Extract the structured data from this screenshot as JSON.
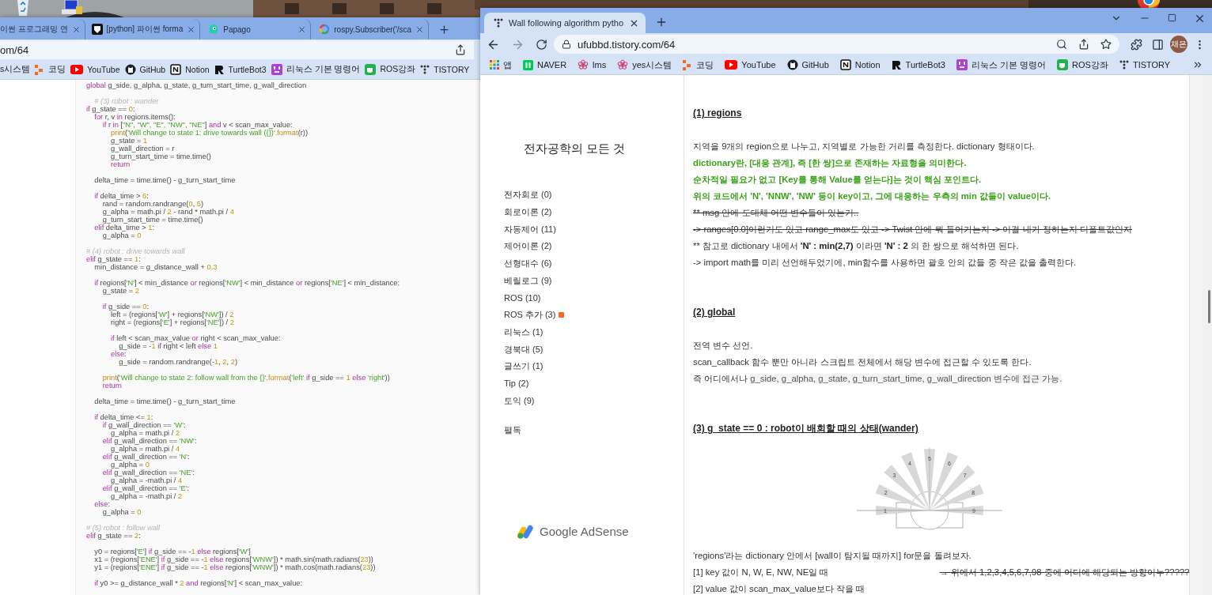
{
  "left_window": {
    "tabs": [
      {
        "title": "이썬 프로그래밍 연",
        "selected": false
      },
      {
        "kind": "python",
        "title": "[python] 파이썬 forma",
        "selected": false
      },
      {
        "kind": "papago",
        "title": "Papago",
        "selected": false
      },
      {
        "kind": "google",
        "title": "rospy.Subscriber('/sca",
        "selected": false
      }
    ],
    "address": "om/64",
    "bookmarks": [
      {
        "label": "s시스템"
      },
      {
        "kind": "coding",
        "label": "코딩"
      },
      {
        "kind": "youtube",
        "label": "YouTube"
      },
      {
        "kind": "github",
        "label": "GitHub"
      },
      {
        "kind": "notion",
        "label": "Notion"
      },
      {
        "kind": "turtlebot",
        "label": "TurtleBot3"
      },
      {
        "kind": "linux",
        "label": "리눅스 기본 명령어"
      },
      {
        "kind": "ros",
        "label": "ROS강좌"
      },
      {
        "kind": "tistory",
        "label": "TISTORY"
      }
    ],
    "code_blocks": [
      [
        {
          "spans": [
            {
              "kind": "keyword",
              "text": "global"
            },
            {
              "kind": "plain",
              "text": " g_side, g_alpha, g_state, g_turn_start_time, g_wall_direction"
            }
          ]
        }
      ],
      [
        {
          "spans": [
            {
              "kind": "comment",
              "text": "    # (3) robot : wander"
            }
          ]
        },
        {
          "spans": [
            {
              "kind": "keyword",
              "text": "if"
            },
            {
              "kind": "plain",
              "text": " g_state == "
            },
            {
              "kind": "number",
              "text": "0"
            },
            {
              "kind": "plain",
              "text": ":"
            }
          ]
        },
        {
          "spans": [
            {
              "kind": "keyword",
              "text": "    for"
            },
            {
              "kind": "plain",
              "text": " r, v "
            },
            {
              "kind": "keyword",
              "text": "in"
            },
            {
              "kind": "plain",
              "text": " regions.items():"
            }
          ]
        },
        {
          "spans": [
            {
              "kind": "keyword",
              "text": "        if"
            },
            {
              "kind": "plain",
              "text": " r "
            },
            {
              "kind": "keyword",
              "text": "in"
            },
            {
              "kind": "plain",
              "text": " ["
            },
            {
              "kind": "string",
              "text": "\"N\", \"W\", \"E\", \"NW\", \"NE\""
            },
            {
              "kind": "plain",
              "text": "] "
            },
            {
              "kind": "keyword",
              "text": "and"
            },
            {
              "kind": "plain",
              "text": " v < scan_max_value:"
            }
          ]
        },
        {
          "spans": [
            {
              "kind": "builtin",
              "text": "            print"
            },
            {
              "kind": "plain",
              "text": "("
            },
            {
              "kind": "string",
              "text": "'Will change to state 1: drive towards wall ({})'"
            },
            {
              "kind": "builtin",
              "text": ".format"
            },
            {
              "kind": "plain",
              "text": "(r))"
            }
          ]
        },
        {
          "spans": [
            {
              "kind": "plain",
              "text": "            g_state = "
            },
            {
              "kind": "number",
              "text": "1"
            }
          ]
        },
        {
          "spans": [
            {
              "kind": "plain",
              "text": "            g_wall_direction = r"
            }
          ]
        },
        {
          "spans": [
            {
              "kind": "plain",
              "text": "            g_turn_start_time = time.time()"
            }
          ]
        },
        {
          "spans": [
            {
              "kind": "keyword",
              "text": "            return"
            }
          ]
        }
      ],
      [
        {
          "spans": [
            {
              "kind": "plain",
              "text": "    delta_time = time.time() - g_turn_start_time"
            }
          ]
        }
      ],
      [
        {
          "spans": [
            {
              "kind": "keyword",
              "text": "    if"
            },
            {
              "kind": "plain",
              "text": " delta_time > "
            },
            {
              "kind": "number",
              "text": "6"
            },
            {
              "kind": "plain",
              "text": ":"
            }
          ]
        },
        {
          "spans": [
            {
              "kind": "plain",
              "text": "        rand = random.randrange("
            },
            {
              "kind": "number",
              "text": "0"
            },
            {
              "kind": "plain",
              "text": ", "
            },
            {
              "kind": "number",
              "text": "5"
            },
            {
              "kind": "plain",
              "text": ")"
            }
          ]
        },
        {
          "spans": [
            {
              "kind": "plain",
              "text": "        g_alpha = math.pi / "
            },
            {
              "kind": "number",
              "text": "2"
            },
            {
              "kind": "plain",
              "text": " - rand * math.pi / "
            },
            {
              "kind": "number",
              "text": "4"
            }
          ]
        },
        {
          "spans": [
            {
              "kind": "plain",
              "text": "        g_turn_start_time = time.time()"
            }
          ]
        },
        {
          "spans": [
            {
              "kind": "keyword",
              "text": "    elif"
            },
            {
              "kind": "plain",
              "text": " delta_time > "
            },
            {
              "kind": "number",
              "text": "1"
            },
            {
              "kind": "plain",
              "text": ":"
            }
          ]
        },
        {
          "spans": [
            {
              "kind": "plain",
              "text": "        g_alpha = "
            },
            {
              "kind": "number",
              "text": "0"
            }
          ]
        }
      ],
      [
        {
          "spans": [
            {
              "kind": "comment",
              "text": "# (4) robot : drive towards wall"
            }
          ]
        },
        {
          "spans": [
            {
              "kind": "keyword",
              "text": "elif"
            },
            {
              "kind": "plain",
              "text": " g_state == "
            },
            {
              "kind": "number",
              "text": "1"
            },
            {
              "kind": "plain",
              "text": ":"
            }
          ]
        },
        {
          "spans": [
            {
              "kind": "plain",
              "text": "    min_distance = g_distance_wall + "
            },
            {
              "kind": "number",
              "text": "0.3"
            }
          ]
        }
      ],
      [
        {
          "spans": [
            {
              "kind": "keyword",
              "text": "    if"
            },
            {
              "kind": "plain",
              "text": " regions["
            },
            {
              "kind": "string",
              "text": "'N'"
            },
            {
              "kind": "plain",
              "text": "] < min_distance "
            },
            {
              "kind": "keyword",
              "text": "or"
            },
            {
              "kind": "plain",
              "text": " regions["
            },
            {
              "kind": "string",
              "text": "'NW'"
            },
            {
              "kind": "plain",
              "text": "] < min_distance "
            },
            {
              "kind": "keyword",
              "text": "or"
            },
            {
              "kind": "plain",
              "text": " regions["
            },
            {
              "kind": "string",
              "text": "'NE'"
            },
            {
              "kind": "plain",
              "text": "] < min_distance:"
            }
          ]
        },
        {
          "spans": [
            {
              "kind": "plain",
              "text": "        g_state = "
            },
            {
              "kind": "number",
              "text": "2"
            }
          ]
        }
      ],
      [
        {
          "spans": [
            {
              "kind": "keyword",
              "text": "        if"
            },
            {
              "kind": "plain",
              "text": " g_side == "
            },
            {
              "kind": "number",
              "text": "0"
            },
            {
              "kind": "plain",
              "text": ":"
            }
          ]
        },
        {
          "spans": [
            {
              "kind": "plain",
              "text": "            left = (regions["
            },
            {
              "kind": "string",
              "text": "'W'"
            },
            {
              "kind": "plain",
              "text": "] + regions["
            },
            {
              "kind": "string",
              "text": "'NW'"
            },
            {
              "kind": "plain",
              "text": "]) / "
            },
            {
              "kind": "number",
              "text": "2"
            }
          ]
        },
        {
          "spans": [
            {
              "kind": "plain",
              "text": "            right = (regions["
            },
            {
              "kind": "string",
              "text": "'E'"
            },
            {
              "kind": "plain",
              "text": "] + regions["
            },
            {
              "kind": "string",
              "text": "'NE'"
            },
            {
              "kind": "plain",
              "text": "]) / "
            },
            {
              "kind": "number",
              "text": "2"
            }
          ]
        }
      ],
      [
        {
          "spans": [
            {
              "kind": "keyword",
              "text": "            if"
            },
            {
              "kind": "plain",
              "text": " left < scan_max_value "
            },
            {
              "kind": "keyword",
              "text": "or"
            },
            {
              "kind": "plain",
              "text": " right < scan_max_value:"
            }
          ]
        },
        {
          "spans": [
            {
              "kind": "plain",
              "text": "                g_side = -"
            },
            {
              "kind": "number",
              "text": "1"
            },
            {
              "kind": "keyword",
              "text": " if"
            },
            {
              "kind": "plain",
              "text": " right < left "
            },
            {
              "kind": "keyword",
              "text": "else"
            },
            {
              "kind": "number",
              "text": " 1"
            }
          ]
        },
        {
          "spans": [
            {
              "kind": "keyword",
              "text": "            else"
            },
            {
              "kind": "plain",
              "text": ":"
            }
          ]
        },
        {
          "spans": [
            {
              "kind": "plain",
              "text": "                g_side = random.randrange(-"
            },
            {
              "kind": "number",
              "text": "1"
            },
            {
              "kind": "plain",
              "text": ", "
            },
            {
              "kind": "number",
              "text": "2"
            },
            {
              "kind": "plain",
              "text": ", "
            },
            {
              "kind": "number",
              "text": "2"
            },
            {
              "kind": "plain",
              "text": ")"
            }
          ]
        }
      ],
      [
        {
          "spans": [
            {
              "kind": "builtin",
              "text": "        print"
            },
            {
              "kind": "plain",
              "text": "("
            },
            {
              "kind": "string",
              "text": "'Will change to state 2: follow wall from the {}'"
            },
            {
              "kind": "builtin",
              "text": ".format"
            },
            {
              "kind": "plain",
              "text": "("
            },
            {
              "kind": "string",
              "text": "'left'"
            },
            {
              "kind": "keyword",
              "text": " if"
            },
            {
              "kind": "plain",
              "text": " g_side == "
            },
            {
              "kind": "number",
              "text": "1"
            },
            {
              "kind": "keyword",
              "text": " else"
            },
            {
              "kind": "string",
              "text": " 'right'"
            },
            {
              "kind": "plain",
              "text": "))"
            }
          ]
        },
        {
          "spans": [
            {
              "kind": "keyword",
              "text": "        return"
            }
          ]
        }
      ],
      [
        {
          "spans": [
            {
              "kind": "plain",
              "text": "    delta_time = time.time() - g_turn_start_time"
            }
          ]
        }
      ],
      [
        {
          "spans": [
            {
              "kind": "keyword",
              "text": "    if"
            },
            {
              "kind": "plain",
              "text": " delta_time <= "
            },
            {
              "kind": "number",
              "text": "1"
            },
            {
              "kind": "plain",
              "text": ":"
            }
          ]
        },
        {
          "spans": [
            {
              "kind": "keyword",
              "text": "        if"
            },
            {
              "kind": "plain",
              "text": " g_wall_direction == "
            },
            {
              "kind": "string",
              "text": "'W'"
            },
            {
              "kind": "plain",
              "text": ":"
            }
          ]
        },
        {
          "spans": [
            {
              "kind": "plain",
              "text": "            g_alpha = math.pi / "
            },
            {
              "kind": "number",
              "text": "2"
            }
          ]
        },
        {
          "spans": [
            {
              "kind": "keyword",
              "text": "        elif"
            },
            {
              "kind": "plain",
              "text": " g_wall_direction == "
            },
            {
              "kind": "string",
              "text": "'NW'"
            },
            {
              "kind": "plain",
              "text": ":"
            }
          ]
        },
        {
          "spans": [
            {
              "kind": "plain",
              "text": "            g_alpha = math.pi / "
            },
            {
              "kind": "number",
              "text": "4"
            }
          ]
        },
        {
          "spans": [
            {
              "kind": "keyword",
              "text": "        elif"
            },
            {
              "kind": "plain",
              "text": " g_wall_direction == "
            },
            {
              "kind": "string",
              "text": "'N'"
            },
            {
              "kind": "plain",
              "text": ":"
            }
          ]
        },
        {
          "spans": [
            {
              "kind": "plain",
              "text": "            g_alpha = "
            },
            {
              "kind": "number",
              "text": "0"
            }
          ]
        },
        {
          "spans": [
            {
              "kind": "keyword",
              "text": "        elif"
            },
            {
              "kind": "plain",
              "text": " g_wall_direction == "
            },
            {
              "kind": "string",
              "text": "'NE'"
            },
            {
              "kind": "plain",
              "text": ":"
            }
          ]
        },
        {
          "spans": [
            {
              "kind": "plain",
              "text": "            g_alpha = -math.pi / "
            },
            {
              "kind": "number",
              "text": "4"
            }
          ]
        },
        {
          "spans": [
            {
              "kind": "keyword",
              "text": "        elif"
            },
            {
              "kind": "plain",
              "text": " g_wall_direction == "
            },
            {
              "kind": "string",
              "text": "'E'"
            },
            {
              "kind": "plain",
              "text": ":"
            }
          ]
        },
        {
          "spans": [
            {
              "kind": "plain",
              "text": "            g_alpha = -math.pi / "
            },
            {
              "kind": "number",
              "text": "2"
            }
          ]
        },
        {
          "spans": [
            {
              "kind": "keyword",
              "text": "    else"
            },
            {
              "kind": "plain",
              "text": ":"
            }
          ]
        },
        {
          "spans": [
            {
              "kind": "plain",
              "text": "        g_alpha = "
            },
            {
              "kind": "number",
              "text": "0"
            }
          ]
        }
      ],
      [
        {
          "spans": [
            {
              "kind": "comment",
              "text": "# (5) robot : follow wall"
            }
          ]
        },
        {
          "spans": [
            {
              "kind": "keyword",
              "text": "elif"
            },
            {
              "kind": "plain",
              "text": " g_state == "
            },
            {
              "kind": "number",
              "text": "2"
            },
            {
              "kind": "plain",
              "text": ":"
            }
          ]
        }
      ],
      [
        {
          "spans": [
            {
              "kind": "plain",
              "text": "    y0 = regions["
            },
            {
              "kind": "string",
              "text": "'E'"
            },
            {
              "kind": "plain",
              "text": "] "
            },
            {
              "kind": "keyword",
              "text": "if"
            },
            {
              "kind": "plain",
              "text": " g_side == -"
            },
            {
              "kind": "number",
              "text": "1"
            },
            {
              "kind": "keyword",
              "text": " else"
            },
            {
              "kind": "plain",
              "text": " regions["
            },
            {
              "kind": "string",
              "text": "'W'"
            },
            {
              "kind": "plain",
              "text": "]"
            }
          ]
        },
        {
          "spans": [
            {
              "kind": "plain",
              "text": "    x1 = (regions["
            },
            {
              "kind": "string",
              "text": "'ENE'"
            },
            {
              "kind": "plain",
              "text": "] "
            },
            {
              "kind": "keyword",
              "text": "if"
            },
            {
              "kind": "plain",
              "text": " g_side == -"
            },
            {
              "kind": "number",
              "text": "1"
            },
            {
              "kind": "keyword",
              "text": " else"
            },
            {
              "kind": "plain",
              "text": " regions["
            },
            {
              "kind": "string",
              "text": "'WNW'"
            },
            {
              "kind": "plain",
              "text": "]) * math.sin(math.radians("
            },
            {
              "kind": "number",
              "text": "23"
            },
            {
              "kind": "plain",
              "text": "))"
            }
          ]
        },
        {
          "spans": [
            {
              "kind": "plain",
              "text": "    y1 = (regions["
            },
            {
              "kind": "string",
              "text": "'ENE'"
            },
            {
              "kind": "plain",
              "text": "] "
            },
            {
              "kind": "keyword",
              "text": "if"
            },
            {
              "kind": "plain",
              "text": " g_side == -"
            },
            {
              "kind": "number",
              "text": "1"
            },
            {
              "kind": "keyword",
              "text": " else"
            },
            {
              "kind": "plain",
              "text": " regions["
            },
            {
              "kind": "string",
              "text": "'WNW'"
            },
            {
              "kind": "plain",
              "text": "]) * math.cos(math.radians("
            },
            {
              "kind": "number",
              "text": "23"
            },
            {
              "kind": "plain",
              "text": "))"
            }
          ]
        }
      ],
      [
        {
          "spans": [
            {
              "kind": "keyword",
              "text": "    if"
            },
            {
              "kind": "plain",
              "text": " y0 >= g_distance_wall * "
            },
            {
              "kind": "number",
              "text": "2"
            },
            {
              "kind": "keyword",
              "text": " and"
            },
            {
              "kind": "plain",
              "text": " regions["
            },
            {
              "kind": "string",
              "text": "'N'"
            },
            {
              "kind": "plain",
              "text": "] < scan_max_value:"
            }
          ]
        }
      ]
    ]
  },
  "right_window": {
    "tabs": [
      {
        "kind": "tistory",
        "title": "Wall following algorithm pytho",
        "selected": true
      }
    ],
    "address": "ufubbd.tistory.com/64",
    "avatar": "채은",
    "bookmarks": [
      {
        "kind": "apps",
        "label": "앱"
      },
      {
        "kind": "naver",
        "label": "NAVER"
      },
      {
        "kind": "flower",
        "label": "lms"
      },
      {
        "kind": "flower",
        "label": "yes시스템"
      },
      {
        "kind": "coding",
        "label": "코딩"
      },
      {
        "kind": "youtube",
        "label": "YouTube"
      },
      {
        "kind": "github",
        "label": "GitHub"
      },
      {
        "kind": "notion",
        "label": "Notion"
      },
      {
        "kind": "turtlebot",
        "label": "TurtleBot3"
      },
      {
        "kind": "linux",
        "label": "리눅스 기본 명령어"
      },
      {
        "kind": "ros",
        "label": "ROS강좌"
      },
      {
        "kind": "tistory",
        "label": "TISTORY"
      }
    ],
    "blog_title": "전자공학의 모든 것",
    "categories": [
      {
        "label": "전자회로 (0)",
        "new": false
      },
      {
        "label": "회로이론 (2)",
        "new": false
      },
      {
        "label": "자동제어 (11)",
        "new": false
      },
      {
        "label": "제어이론 (2)",
        "new": false
      },
      {
        "label": "선형대수 (6)",
        "new": false
      },
      {
        "label": "베릴로그 (9)",
        "new": false
      },
      {
        "label": "ROS (10)",
        "new": false
      },
      {
        "label": "ROS 추가 (3)",
        "new": true
      },
      {
        "label": "리눅스 (1)",
        "new": false
      },
      {
        "label": "경북대 (5)",
        "new": false
      },
      {
        "label": "글쓰기 (1)",
        "new": false
      },
      {
        "label": "Tip (2)",
        "new": false
      },
      {
        "label": "토익 (9)",
        "new": false
      }
    ],
    "sidebar_link": "펼독",
    "ad_label": "Google AdSense",
    "article": [
      {
        "kind": "heading",
        "text": "(1) regions"
      },
      {
        "kind": "text",
        "text": "지역을 9개의 region으로 나누고, 지역별로 가능한 거리를 측정한다. dictionary 형태이다."
      },
      {
        "kind": "green",
        "text": "dictionary란, [대응 관계], 즉 [한 쌍]으로 존재하는 자료형을 의미한다."
      },
      {
        "kind": "green",
        "text": "순차적일 필요가 없고 [Key를 통해 Value를 얻는다]는 것이 핵심 포인트다."
      },
      {
        "kind": "green",
        "text": "위의 코드에서 'N', 'NNW', 'NW' 등이 key이고, 그에 대응하는 우측의 min 값들이 value이다."
      },
      {
        "kind": "strike",
        "text": "** msg 안에 도대체 어떤 변수들이 있는거.."
      },
      {
        "kind": "strike",
        "text": "-> ranges[0.0]이런거도 있고 range_max도 있고 -> Twist 안에 뭐 들어가는지 -> 이걸 내가 정하는지 디폴트값인지"
      },
      {
        "kind": "parts",
        "parts": [
          {
            "kind": "plain",
            "text": "** 참고로 dictionary 내에서 "
          },
          {
            "kind": "bold",
            "text": "'N' : min(2,7)"
          },
          {
            "kind": "plain",
            "text": " 이라면 "
          },
          {
            "kind": "bold",
            "text": "'N' : 2"
          },
          {
            "kind": "plain",
            "text": " 의 한 쌍으로 해석하면 된다."
          }
        ]
      },
      {
        "kind": "text",
        "text": "-> import math를 미리 선언해두었기에, min함수를 사용하면 괄호 안의 값들 중 작은 값을 출력한다."
      },
      {
        "kind": "heading",
        "text": "(2) global"
      },
      {
        "kind": "text",
        "text": "전역 변수 선언."
      },
      {
        "kind": "text",
        "text": "scan_callback 함수 뿐만 아니라 스크립트 전체에서 해당 변수에 접근할 수 있도록 한다."
      },
      {
        "kind": "parts",
        "parts": [
          {
            "kind": "plain",
            "text": "즉 어디에서나 "
          },
          {
            "kind": "mark",
            "text": "g_side, g_alpha, g_state, g_turn_start_time, g_wall_direction 변수에 접근 가능."
          }
        ]
      },
      {
        "kind": "heading",
        "text": "(3) g_state == 0 : robot이 배회할 때의 상태(wander)"
      },
      {
        "kind": "figure",
        "labels": [
          "1",
          "2",
          "3",
          "4",
          "5",
          "6",
          "7",
          "8",
          "9"
        ]
      },
      {
        "kind": "text",
        "text": "'regions'라는 dictionary 안에서 [wall이 탐지될 때까지] for문을 돌려보자."
      },
      {
        "kind": "parts",
        "parts": [
          {
            "kind": "plain",
            "text": "[1] key 값이 N, W, E, NW, NE일 때"
          },
          {
            "kind": "strike",
            "text": "→ 위에서 1,2,3,4,5,6,7,98 중에 어디에 해당되는 방향이누?????"
          }
        ]
      },
      {
        "kind": "text",
        "text": "[2] value 값이 scan_max_value보다 작을 때"
      }
    ]
  }
}
